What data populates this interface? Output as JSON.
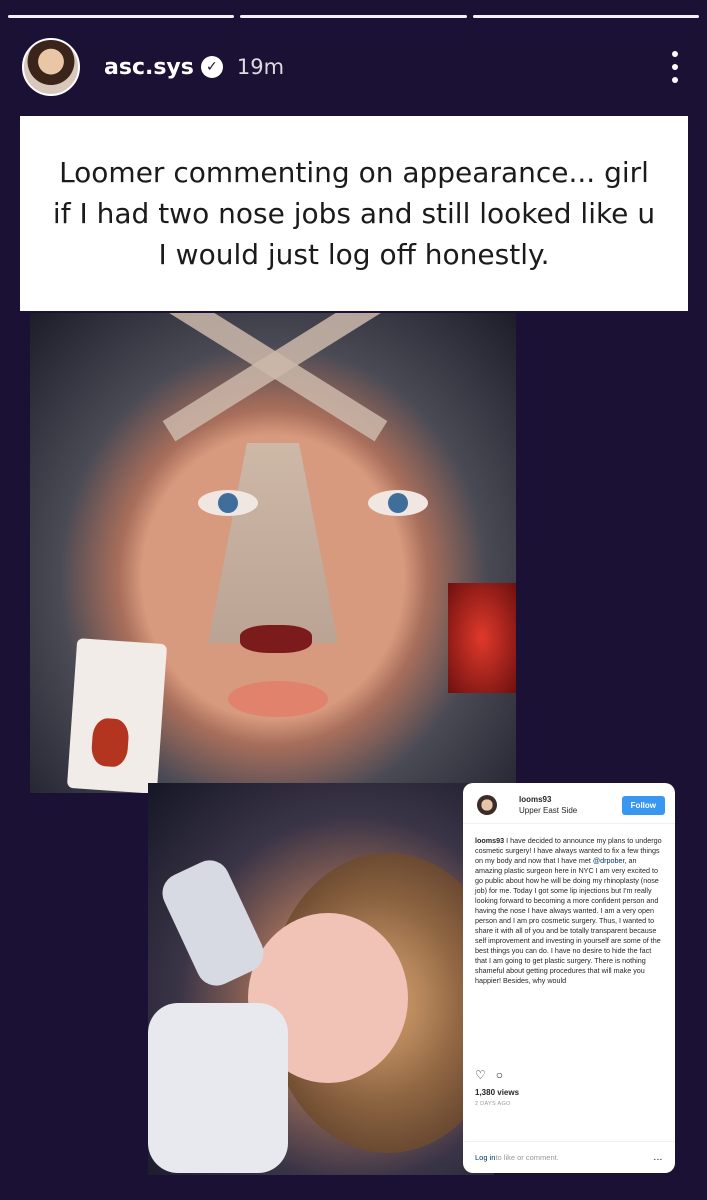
{
  "story": {
    "progress_segments": [
      {
        "state": "done"
      },
      {
        "state": "done"
      },
      {
        "state": "active"
      }
    ],
    "username": "asc.sys",
    "verified_icon": "verified-badge-icon",
    "time": "19m",
    "more_icon": "more-vertical-icon"
  },
  "caption": {
    "text": "Loomer commenting on appearance... girl if I had two nose jobs and still looked like u I would just log off honestly."
  },
  "instagram_post": {
    "user": "looms93",
    "location": "Upper East Side",
    "follow_label": "Follow",
    "caption_user": "looms93",
    "caption_part1": " I have decided to announce my plans to undergo cosmetic surgery! I have always wanted to fix a few things on my body and now that I have met ",
    "mention": "@drpober",
    "caption_part2": ", an amazing plastic surgeon here in NYC I am very excited to go public about how he will be doing my rhinoplasty (nose job) for me. Today I got some lip injections but I'm really looking forward to becoming a more confident person and having the nose I have always wanted. I am a very open person and I am pro cosmetic surgery. Thus, I wanted to share it with all of you and be totally transparent because self improvement and investing in yourself are some of the best things you can do. I have no desire to hide the fact that I am going to get plastic surgery. There is nothing shameful about getting procedures that will make you happier! Besides, why would",
    "views": "1,380 views",
    "ago": "2 DAYS AGO",
    "login_text": "Log in",
    "login_rest": " to like or comment.",
    "more_label": "..."
  }
}
